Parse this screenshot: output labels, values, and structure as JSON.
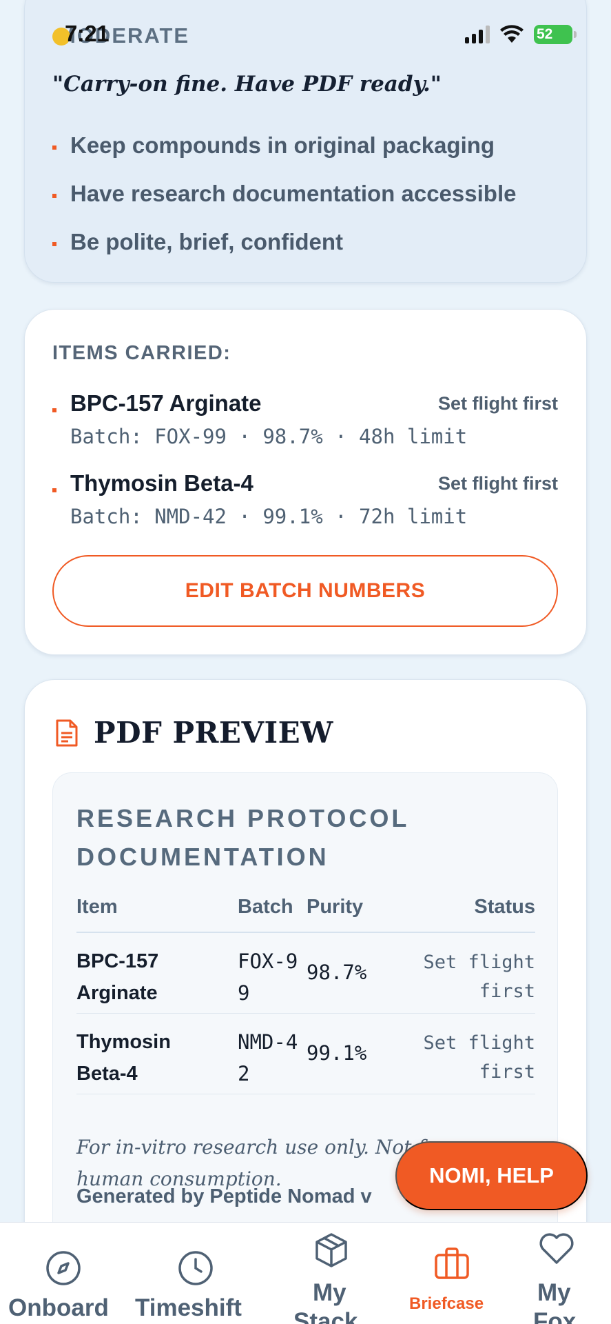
{
  "status_bar": {
    "time": "7:21",
    "battery": "52"
  },
  "moderate_card": {
    "label": "MODERATE",
    "quote": "\"Carry-on fine. Have PDF ready.\"",
    "bullets": [
      "Keep compounds in original packaging",
      "Have research documentation accessible",
      "Be polite, brief, confident"
    ]
  },
  "items_card": {
    "heading": "ITEMS CARRIED:",
    "items": [
      {
        "name": "BPC-157 Arginate",
        "status": "Set flight first",
        "meta": "Batch: FOX-99 · 98.7% · 48h limit"
      },
      {
        "name": "Thymosin Beta-4",
        "status": "Set flight first",
        "meta": "Batch: NMD-42 · 99.1% · 72h limit"
      }
    ],
    "edit_button": "EDIT BATCH NUMBERS"
  },
  "pdf_card": {
    "title": "PDF PREVIEW",
    "doc_title": "RESEARCH PROTOCOL DOCUMENTATION",
    "columns": [
      "Item",
      "Batch",
      "Purity",
      "Status"
    ],
    "rows": [
      {
        "item": "BPC-157 Arginate",
        "batch": "FOX-99",
        "purity": "98.7%",
        "status": "Set flight first"
      },
      {
        "item": "Thymosin Beta-4",
        "batch": "NMD-42",
        "purity": "99.1%",
        "status": "Set flight first"
      }
    ],
    "disclaimer": "For in-vitro research use only. Not for human consumption.",
    "generated": "Generated by Peptide Nomad v"
  },
  "help_button": "NOMI, HELP",
  "nav": {
    "items": [
      {
        "label": "Onboard",
        "icon": "compass-icon"
      },
      {
        "label": "Timeshift",
        "icon": "clock-icon"
      },
      {
        "label_line1": "My",
        "label_line2": "Stack",
        "icon": "box-icon"
      },
      {
        "label": "Briefcase",
        "icon": "briefcase-icon",
        "active": true
      },
      {
        "label_line1": "My",
        "label_line2": "Fox",
        "icon": "heart-icon"
      }
    ]
  },
  "colors": {
    "accent": "#f05a24",
    "text_muted": "#4f6174",
    "background": "#eaf3fa"
  }
}
